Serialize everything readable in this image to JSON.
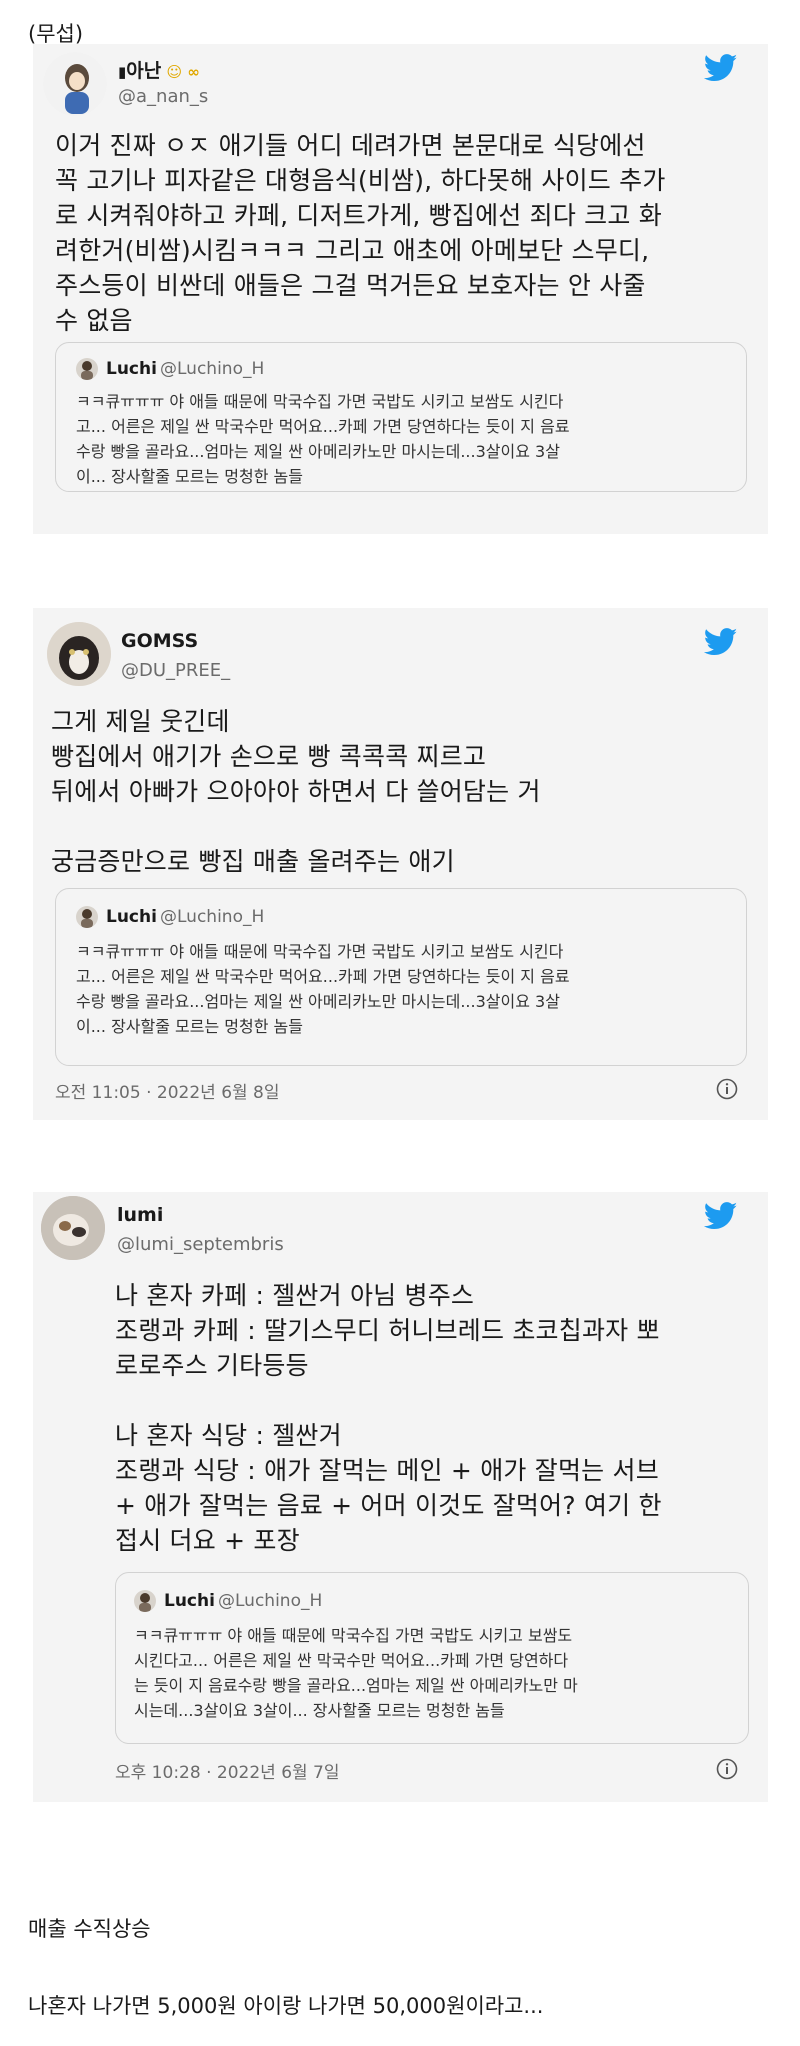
{
  "header_note": "(무섭)",
  "tweets": [
    {
      "name": "아난",
      "name_emoji": "🍞 😷 🎗",
      "handle": "@a_nan_s",
      "body": "이거 진짜 ㅇㅈ 애기들 어디 데려가면 본문대로 식당에선\n꼭 고기나 피자같은 대형음식(비쌈), 하다못해 사이드 추가\n로 시켜줘야하고 카페, 디저트가게, 빵집에선 죄다 크고 화\n려한거(비쌈)시킴ㅋㅋㅋ 그리고 애초에 아메보단 스무디,\n주스등이 비싼데 애들은 그걸 먹거든요 보호자는 안 사줄\n수 없음",
      "quote": {
        "name": "Luchi",
        "handle": "@Luchino_H",
        "text": "ㅋㅋ큐ㅠㅠㅠ 야 애들 때문에 막국수집 가면 국밥도 시키고 보쌈도 시킨다\n고... 어른은 제일 싼 막국수만 먹어요...카페 가면 당연하다는 듯이 지 음료\n수랑 빵을 골라요...엄마는 제일 싼 아메리카노만 마시는데...3살이요 3살\n이... 장사할줄 모르는 멍청한 놈들"
      }
    },
    {
      "name": "GOMSS",
      "handle": "@DU_PREE_",
      "body": "그게 제일 웃긴데\n빵집에서 애기가 손으로 빵 콕콕콕 찌르고\n뒤에서 아빠가 으아아아 하면서 다 쓸어담는 거\n\n궁금증만으로 빵집 매출 올려주는 애기",
      "quote": {
        "name": "Luchi",
        "handle": "@Luchino_H",
        "text": "ㅋㅋ큐ㅠㅠㅠ 야 애들 때문에 막국수집 가면 국밥도 시키고 보쌈도 시킨다\n고... 어른은 제일 싼 막국수만 먹어요...카페 가면 당연하다는 듯이 지 음료\n수랑 빵을 골라요...엄마는 제일 싼 아메리카노만 마시는데...3살이요 3살\n이... 장사할줄 모르는 멍청한 놈들"
      },
      "timestamp": "오전 11:05 · 2022년 6월 8일"
    },
    {
      "name": "lumi",
      "handle": "@lumi_septembris",
      "body": "나 혼자 카페 : 젤싼거 아님 병주스\n조랭과 카페 : 딸기스무디 허니브레드 초코칩과자 뽀\n로로주스 기타등등\n\n나 혼자 식당 : 젤싼거\n조랭과 식당 : 애가 잘먹는 메인 + 애가 잘먹는 서브\n+ 애가 잘먹는 음료 + 어머 이것도 잘먹어? 여기 한\n접시 더요 + 포장",
      "quote": {
        "name": "Luchi",
        "handle": "@Luchino_H",
        "text": "ㅋㅋ큐ㅠㅠㅠ 야 애들 때문에 막국수집 가면 국밥도 시키고 보쌈도\n시킨다고... 어른은 제일 싼 막국수만 먹어요...카페 가면 당연하다\n는 듯이 지 음료수랑 빵을 골라요...엄마는 제일 싼 아메리카노만 마\n시는데...3살이요 3살이... 장사할줄 모르는 멍청한 놈들"
      },
      "timestamp": "오후 10:28 · 2022년 6월 7일"
    }
  ],
  "footer_line1": "매출 수직상승",
  "footer_line2": "나혼자 나가면 5,000원 아이랑 나가면 50,000원이라고...",
  "colors": {
    "twitter_blue": "#1d9bf0",
    "card_bg": "#f4f4f4",
    "muted": "#6b6b6b"
  },
  "icons": {
    "brand": "twitter-bird-icon",
    "info": "info-icon"
  }
}
